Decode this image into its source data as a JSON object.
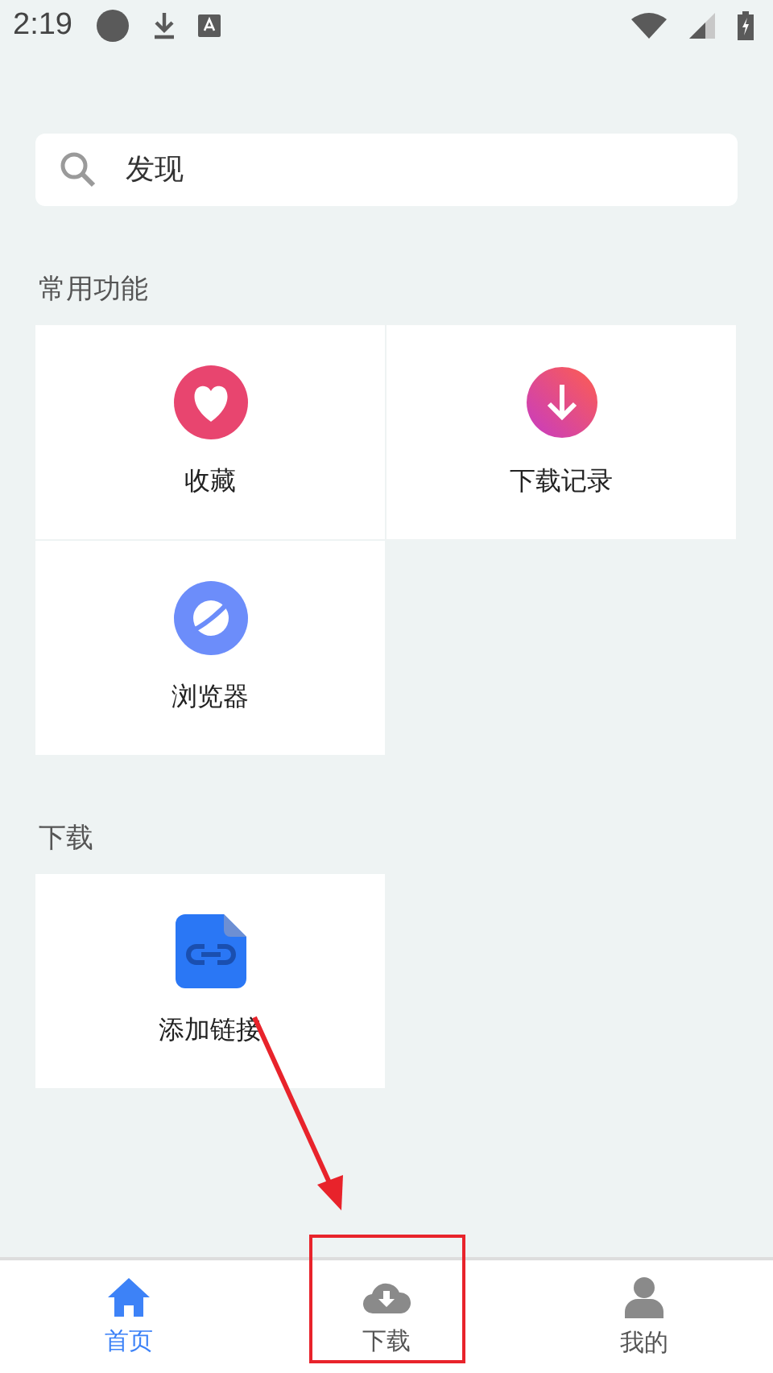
{
  "status_bar": {
    "time": "2:19"
  },
  "search": {
    "placeholder": "发现"
  },
  "sections": [
    {
      "title": "常用功能",
      "items": [
        {
          "label": "收藏",
          "kind": "heart"
        },
        {
          "label": "下载记录",
          "kind": "download"
        },
        {
          "label": "浏览器",
          "kind": "planet"
        }
      ]
    },
    {
      "title": "下载",
      "items": [
        {
          "label": "添加链接",
          "kind": "link"
        }
      ]
    }
  ],
  "tabs": [
    {
      "label": "首页",
      "kind": "home",
      "selected": true
    },
    {
      "label": "下载",
      "kind": "cloud",
      "selected": false
    },
    {
      "label": "我的",
      "kind": "user",
      "selected": false
    }
  ]
}
